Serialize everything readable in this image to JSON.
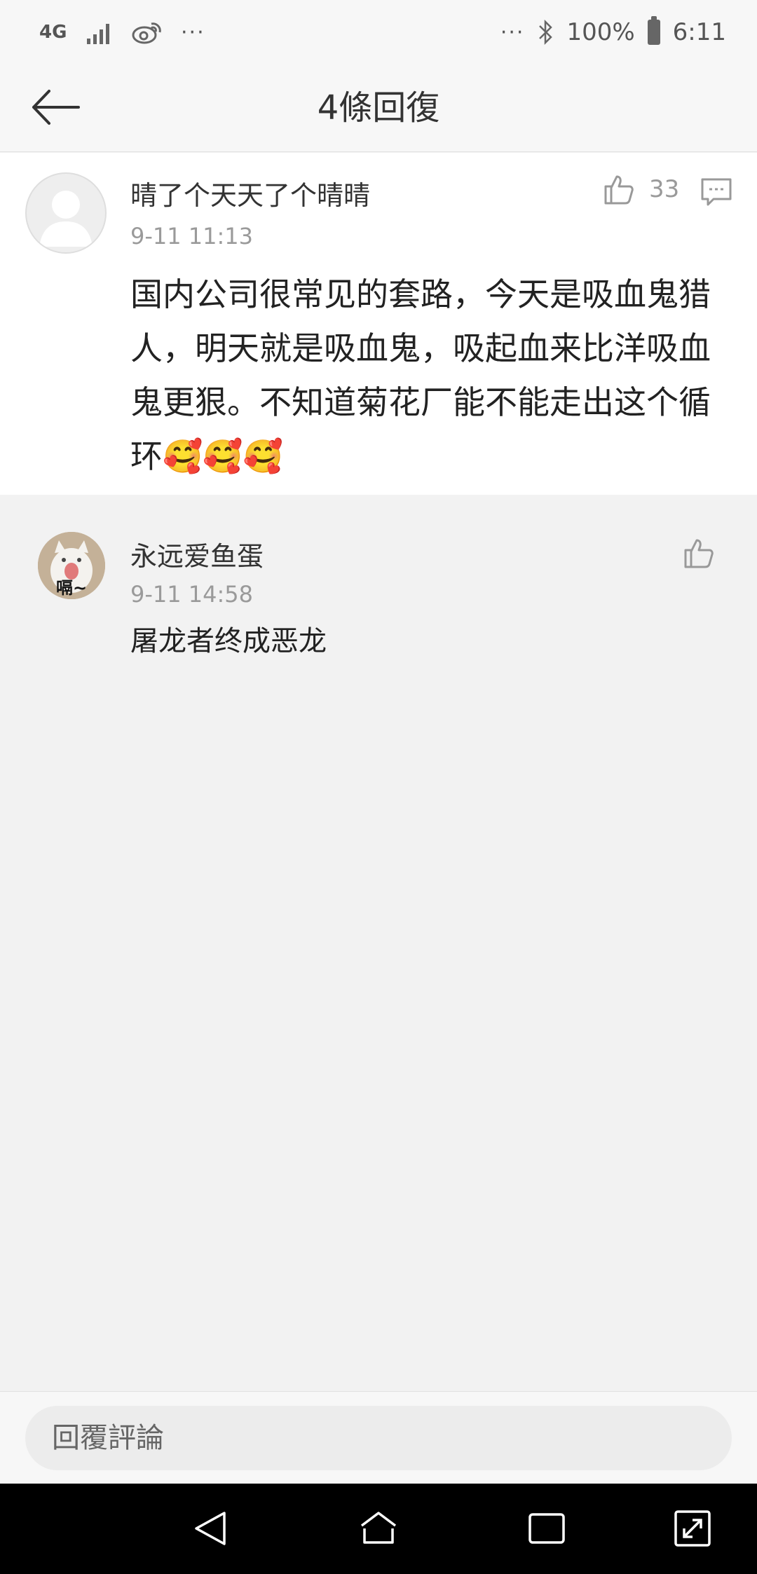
{
  "status_bar": {
    "network": "4G",
    "more": "···",
    "right_more": "···",
    "battery": "100%",
    "time": "6:11"
  },
  "header": {
    "title": "4條回復",
    "back_icon": "arrow-left-icon"
  },
  "comments": [
    {
      "author": "晴了个天天了个晴晴",
      "time": "9-11 11:13",
      "text": "国内公司很常见的套路，今天是吸血鬼猎人，明天就是吸血鬼，吸起血来比洋吸血鬼更狠。不知道菊花厂能不能走出这个循环🥰🥰🥰",
      "likes": "33",
      "avatar": "default-avatar"
    },
    {
      "author": "永远爱鱼蛋",
      "time": "9-11 14:58",
      "text": "屠龙者终成恶龙",
      "avatar_caption": "嗝~",
      "avatar": "cat-avatar"
    }
  ],
  "reply": {
    "placeholder": "回覆評論"
  },
  "colors": {
    "background": "#f2f2f2",
    "card": "#ffffff",
    "muted": "#9a9a9a",
    "system_nav": "#000000"
  }
}
